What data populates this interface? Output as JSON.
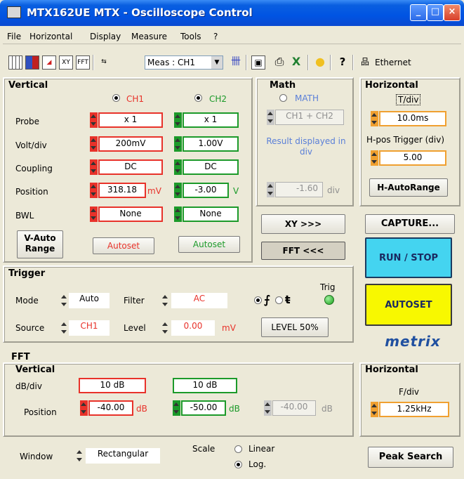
{
  "window": {
    "title": "MTX162UE MTX - Oscilloscope Control"
  },
  "menu": [
    "File",
    "Horizontal",
    "Display",
    "Measure",
    "Tools",
    "?"
  ],
  "toolbar": {
    "meas_select": "Meas : CH1",
    "xy_label": "XY",
    "fft_label": "FFT",
    "connection": "Ethernet"
  },
  "vertical": {
    "title": "Vertical",
    "ch1": "CH1",
    "ch2": "CH2",
    "rows": [
      "Probe",
      "Volt/div",
      "Coupling",
      "Position",
      "BWL"
    ],
    "ch1_values": {
      "probe": "x 1",
      "volt": "200mV",
      "coupling": "DC",
      "position": "318.18",
      "position_unit": "mV",
      "bwl": "None"
    },
    "ch2_values": {
      "probe": "x 1",
      "volt": "1.00V",
      "coupling": "DC",
      "position": "-3.00",
      "position_unit": "V",
      "bwl": "None"
    },
    "vauto": "V-Auto Range",
    "autoset1": "Autoset",
    "autoset2": "Autoset"
  },
  "math": {
    "title": "Math",
    "radio": "MATH",
    "expr": "CH1 + CH2",
    "note": "Result displayed in div",
    "position": "-1.60",
    "unit": "div",
    "xy_btn": "XY >>>",
    "fft_btn": "FFT <<<"
  },
  "horizontal": {
    "title": "Horizontal",
    "tdiv_label": "T/div",
    "tdiv": "10.0ms",
    "hpos_label": "H-pos Trigger (div)",
    "hpos": "5.00",
    "hauto": "H-AutoRange"
  },
  "trigger": {
    "title": "Trigger",
    "mode_label": "Mode",
    "mode": "Auto",
    "filter_label": "Filter",
    "filter": "AC",
    "source_label": "Source",
    "source": "CH1",
    "level_label": "Level",
    "level": "0.00",
    "level_unit": "mV",
    "trig_label": "Trig",
    "level50": "LEVEL 50%"
  },
  "buttons": {
    "capture": "CAPTURE...",
    "runstop": "RUN / STOP",
    "autoset": "AUTOSET",
    "logo": "metrix"
  },
  "fft": {
    "title": "FFT",
    "vertical_title": "Vertical",
    "dbdiv_label": "dB/div",
    "ch1_db": "10 dB",
    "ch2_db": "10 dB",
    "position_label": "Position",
    "ch1_pos": "-40.00",
    "ch2_pos": "-50.00",
    "math_pos": "-40.00",
    "db_unit": "dB",
    "horizontal_title": "Horizontal",
    "fdiv_label": "F/div",
    "fdiv": "1.25kHz",
    "window_label": "Window",
    "window": "Rectangular",
    "scale_label": "Scale",
    "linear": "Linear",
    "log": "Log.",
    "peak": "Peak Search"
  }
}
